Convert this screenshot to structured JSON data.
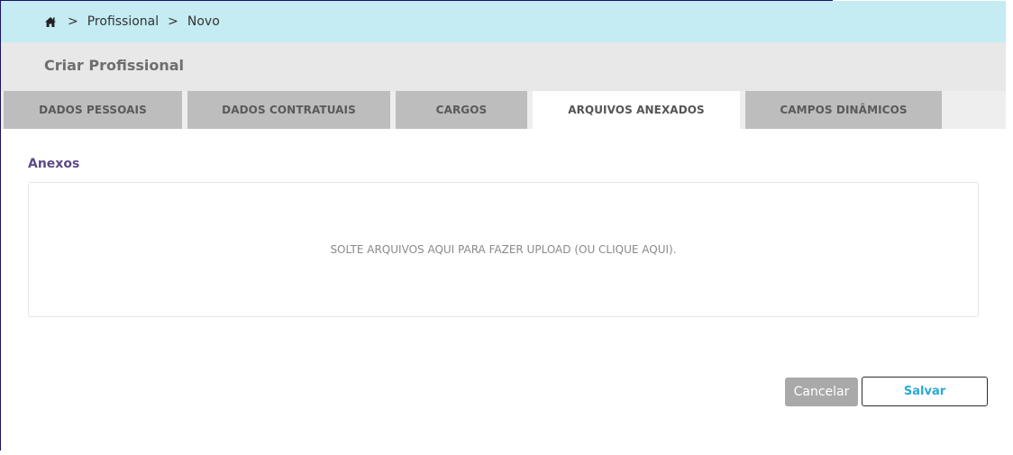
{
  "breadcrumb": {
    "home_icon": "home-icon",
    "separator": ">",
    "items": [
      "Profissional",
      "Novo"
    ]
  },
  "header": {
    "title": "Criar Profissional"
  },
  "tabs": [
    {
      "label": "DADOS PESSOAIS",
      "active": false
    },
    {
      "label": "DADOS CONTRATUAIS",
      "active": false
    },
    {
      "label": "CARGOS",
      "active": false
    },
    {
      "label": "ARQUIVOS ANEXADOS",
      "active": true
    },
    {
      "label": "CAMPOS DINÂMICOS",
      "active": false
    }
  ],
  "attachments": {
    "section_label": "Anexos",
    "dropzone_text": "SOLTE ARQUIVOS AQUI PARA FAZER UPLOAD (OU CLIQUE AQUI)."
  },
  "actions": {
    "cancel_label": "Cancelar",
    "save_label": "Salvar"
  },
  "colors": {
    "breadcrumb_bg": "#c5ebf3",
    "header_bg": "#e8e8e8",
    "tab_bg": "#bdbdbd",
    "active_tab_bg": "#ffffff",
    "section_label": "#5b4a86",
    "save_text": "#29a8d9",
    "cancel_bg": "#a9a9a9"
  }
}
